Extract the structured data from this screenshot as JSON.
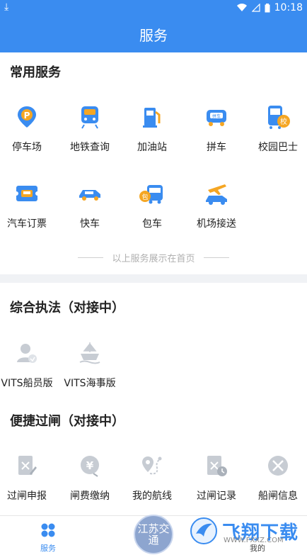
{
  "status": {
    "time": "10:18"
  },
  "header": {
    "title": "服务"
  },
  "sections": {
    "common": {
      "title": "常用服务"
    },
    "enforce": {
      "title": "综合执法（对接中）"
    },
    "lock": {
      "title": "便捷过闸（对接中）"
    }
  },
  "common_items": [
    {
      "label": "停车场",
      "icon": "parking-icon"
    },
    {
      "label": "地铁查询",
      "icon": "metro-icon"
    },
    {
      "label": "加油站",
      "icon": "gas-station-icon"
    },
    {
      "label": "拼车",
      "icon": "carpool-icon"
    },
    {
      "label": "校园巴士",
      "icon": "school-bus-icon"
    },
    {
      "label": "汽车订票",
      "icon": "bus-ticket-icon"
    },
    {
      "label": "快车",
      "icon": "express-car-icon"
    },
    {
      "label": "包车",
      "icon": "charter-bus-icon"
    },
    {
      "label": "机场接送",
      "icon": "airport-transfer-icon"
    }
  ],
  "note": "以上服务展示在首页",
  "enforce_items": [
    {
      "label": "VITS船员版",
      "icon": "crew-icon"
    },
    {
      "label": "VITS海事版",
      "icon": "maritime-icon"
    }
  ],
  "lock_items": [
    {
      "label": "过闸申报",
      "icon": "lock-declare-icon"
    },
    {
      "label": "闸费缴纳",
      "icon": "fee-pay-icon"
    },
    {
      "label": "我的航线",
      "icon": "route-icon"
    },
    {
      "label": "过闸记录",
      "icon": "lock-record-icon"
    },
    {
      "label": "船闸信息",
      "icon": "lock-info-icon"
    }
  ],
  "tabbar": {
    "service": "服务",
    "center_logo": "江苏交通",
    "mine": "我的"
  },
  "watermark": {
    "text": "飞翔下载",
    "url": "WWW.FXXZ.COM"
  },
  "colors": {
    "primary": "#3a8cf0",
    "accent_orange": "#f5a623",
    "gray_icon": "#c7ccd3"
  }
}
